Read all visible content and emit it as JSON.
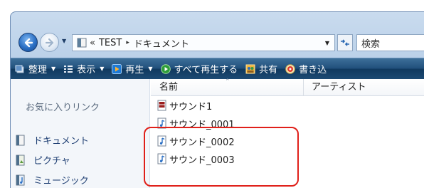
{
  "address_bar": {
    "overflow": "«",
    "segments": [
      "TEST",
      "ドキュメント"
    ],
    "separator": "▸"
  },
  "search": {
    "placeholder": "検索"
  },
  "command_bar": {
    "items": [
      {
        "label": "整理",
        "icon": "organize-icon",
        "has_dropdown": true
      },
      {
        "label": "表示",
        "icon": "views-icon",
        "has_dropdown": true
      },
      {
        "label": "再生",
        "icon": "play-icon",
        "has_dropdown": true
      },
      {
        "label": "すべて再生する",
        "icon": "play-all-icon",
        "has_dropdown": false
      },
      {
        "label": "共有",
        "icon": "share-icon",
        "has_dropdown": false
      },
      {
        "label": "書き込",
        "icon": "burn-icon",
        "has_dropdown": false
      }
    ]
  },
  "nav_pane": {
    "header": "お気に入りリンク",
    "links": [
      {
        "label": "ドキュメント",
        "icon": "documents-icon"
      },
      {
        "label": "ピクチャ",
        "icon": "pictures-icon"
      },
      {
        "label": "ミュージック",
        "icon": "music-icon"
      }
    ]
  },
  "columns": {
    "name": "名前",
    "artist": "アーティスト"
  },
  "files": [
    {
      "name": "サウンド1",
      "icon": "media-file-icon"
    },
    {
      "name": "サウンド_0001",
      "icon": "audio-file-icon"
    },
    {
      "name": "サウンド_0002",
      "icon": "audio-file-icon"
    },
    {
      "name": "サウンド_0003",
      "icon": "audio-file-icon"
    }
  ],
  "colors": {
    "command_bar": "#21507c",
    "highlight": "#e0201a",
    "link": "#1f3f73"
  }
}
